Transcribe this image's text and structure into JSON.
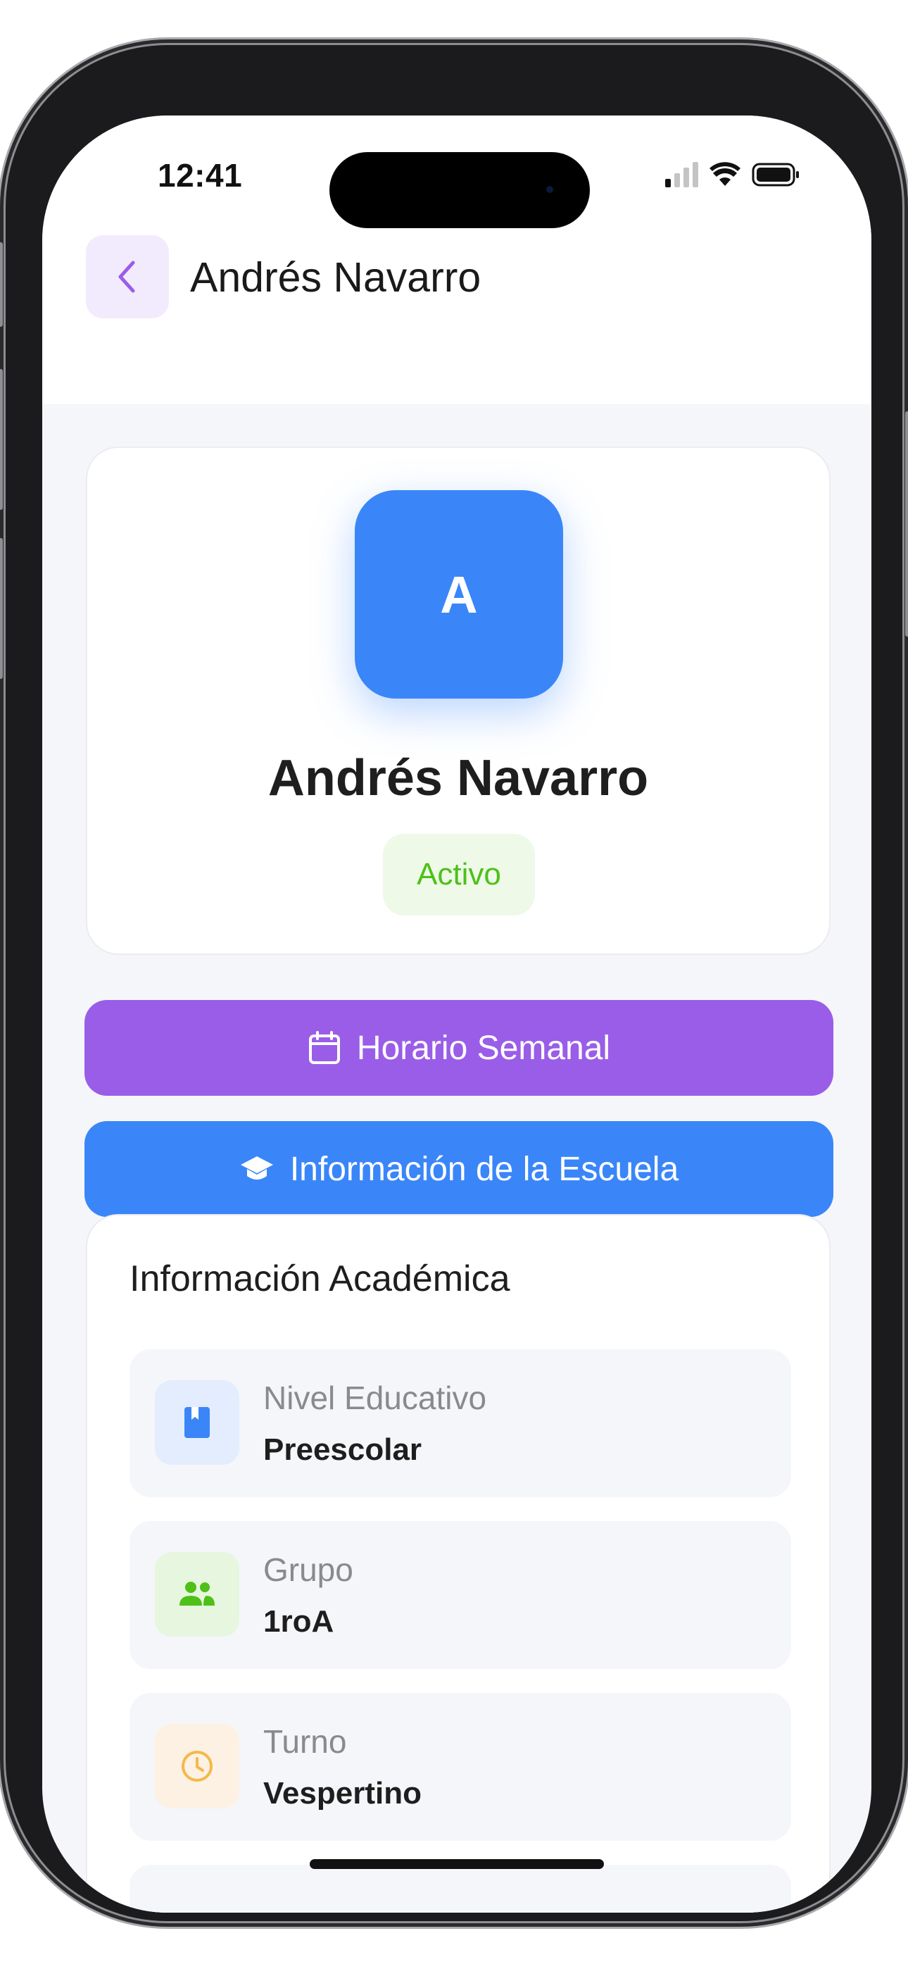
{
  "status_bar": {
    "time": "12:41"
  },
  "header": {
    "title": "Andrés Navarro"
  },
  "profile": {
    "avatar_initial": "A",
    "name": "Andrés Navarro",
    "status": "Activo"
  },
  "actions": {
    "schedule_label": "Horario Semanal",
    "school_label": "Información de la Escuela"
  },
  "academic": {
    "title": "Información Académica",
    "items": [
      {
        "label": "Nivel Educativo",
        "value": "Preescolar",
        "icon": "book-icon"
      },
      {
        "label": "Grupo",
        "value": "1roA",
        "icon": "group-icon"
      },
      {
        "label": "Turno",
        "value": "Vespertino",
        "icon": "clock-icon"
      }
    ]
  },
  "colors": {
    "purple_accent": "#9a5de8",
    "blue_accent": "#3a86f8",
    "active_green": "#4ec018",
    "background": "#f4f6fa"
  }
}
